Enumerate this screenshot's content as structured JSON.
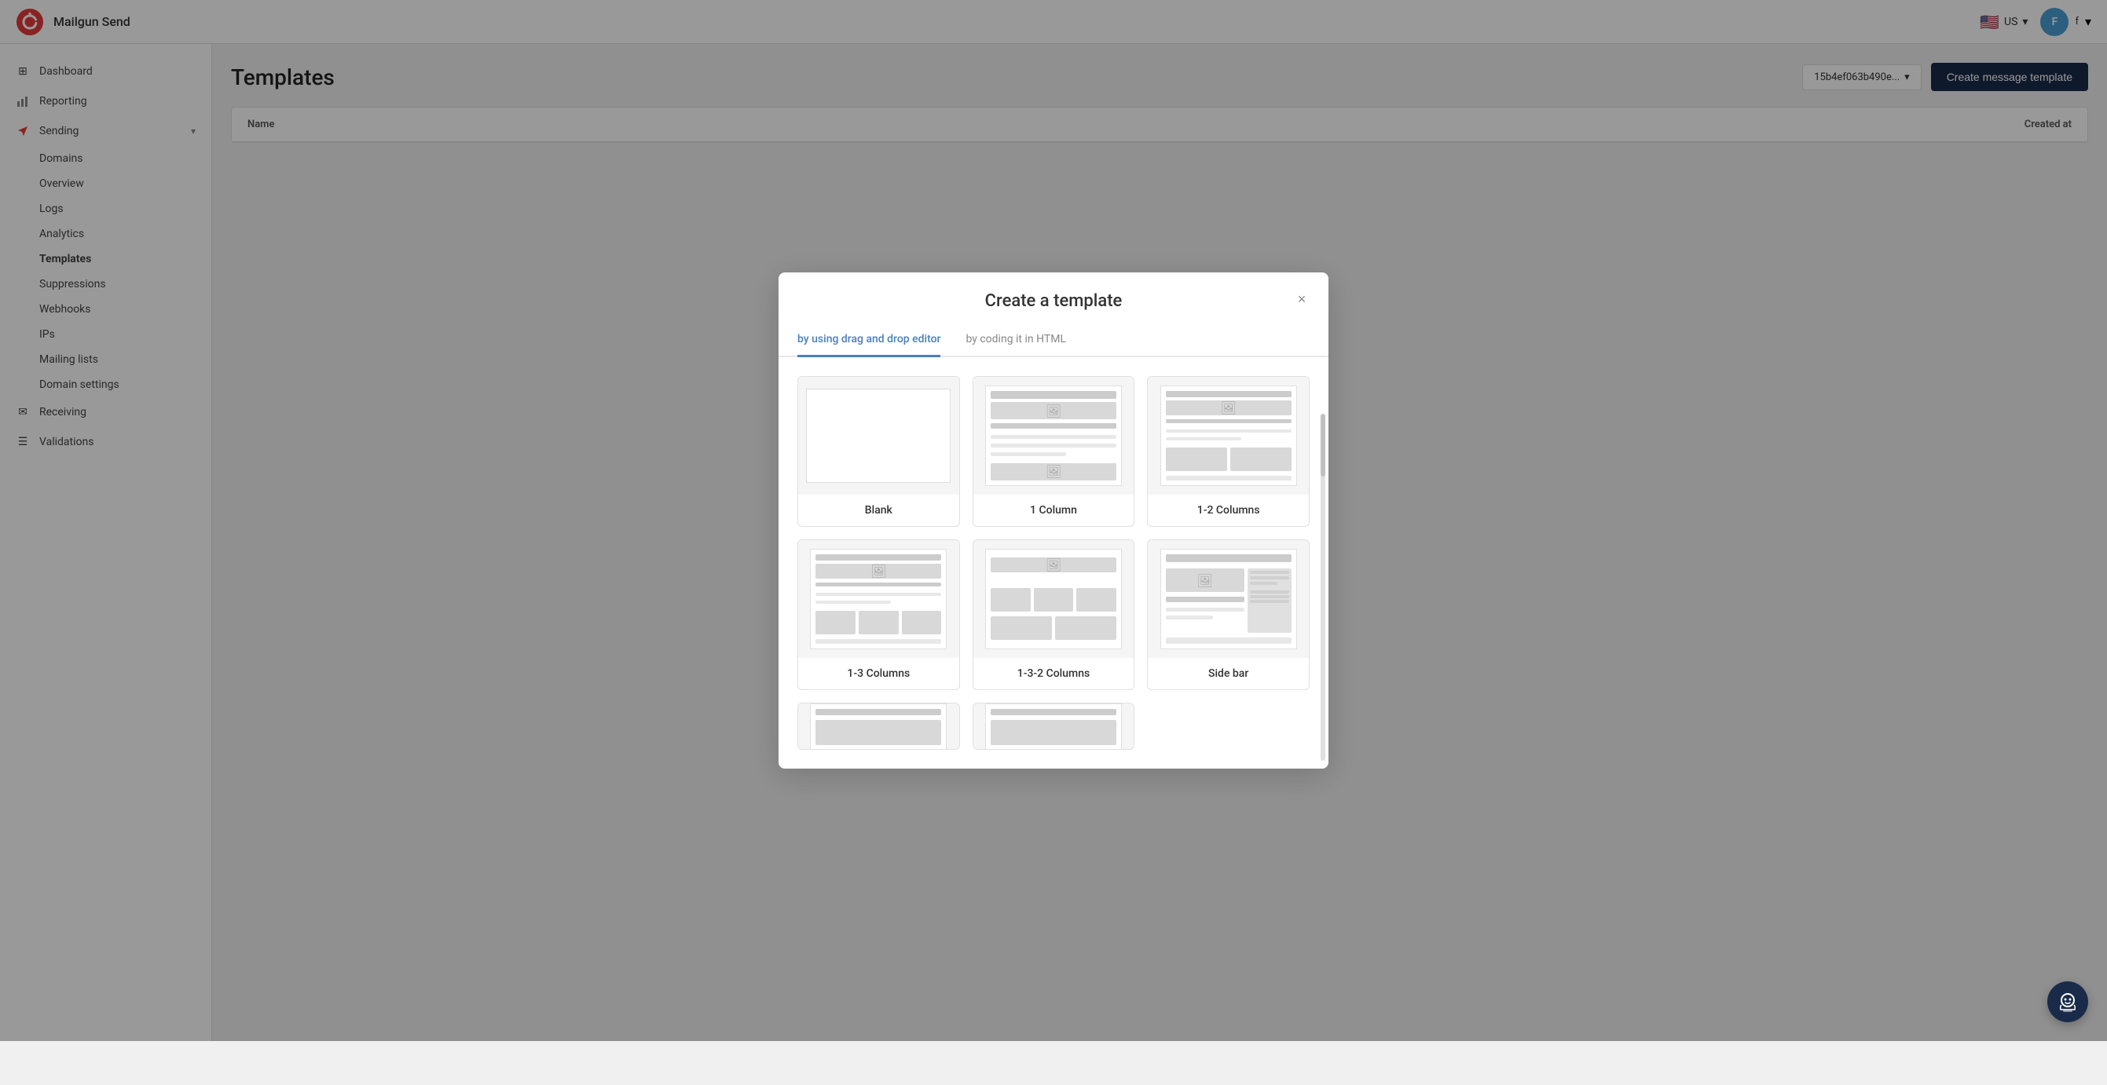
{
  "app": {
    "name": "Mailgun Send",
    "logo_text": "⚙"
  },
  "topnav": {
    "lang": "US",
    "user_initial": "F",
    "user_name": "f",
    "user_sub": "f",
    "chevron": "▾"
  },
  "sidebar": {
    "items": [
      {
        "id": "dashboard",
        "label": "Dashboard",
        "icon": "⊞"
      },
      {
        "id": "reporting",
        "label": "Reporting",
        "icon": "📊"
      },
      {
        "id": "sending",
        "label": "Sending",
        "icon": "✈",
        "has_chevron": true
      },
      {
        "id": "domains",
        "label": "Domains",
        "icon": ""
      },
      {
        "id": "overview",
        "label": "Overview",
        "icon": ""
      },
      {
        "id": "logs",
        "label": "Logs",
        "icon": ""
      },
      {
        "id": "analytics",
        "label": "Analytics",
        "icon": ""
      },
      {
        "id": "templates",
        "label": "Templates",
        "icon": "",
        "active": true
      },
      {
        "id": "suppressions",
        "label": "Suppressions",
        "icon": ""
      },
      {
        "id": "webhooks",
        "label": "Webhooks",
        "icon": ""
      },
      {
        "id": "ips",
        "label": "IPs",
        "icon": ""
      },
      {
        "id": "mailing-lists",
        "label": "Mailing lists",
        "icon": ""
      },
      {
        "id": "domain-settings",
        "label": "Domain settings",
        "icon": ""
      },
      {
        "id": "receiving",
        "label": "Receiving",
        "icon": "✉"
      },
      {
        "id": "validations",
        "label": "Validations",
        "icon": "☰"
      }
    ]
  },
  "page": {
    "title": "Templates",
    "domain_value": "15b4ef063b490e...",
    "create_btn_label": "Create message template",
    "table": {
      "col_name": "Name",
      "col_created": "Created at"
    }
  },
  "modal": {
    "title": "Create a template",
    "close_label": "×",
    "tabs": [
      {
        "id": "drag-drop",
        "label": "by using drag and drop editor",
        "active": true
      },
      {
        "id": "html",
        "label": "by coding it in HTML",
        "active": false
      }
    ],
    "templates": [
      {
        "id": "blank",
        "label": "Blank",
        "type": "blank"
      },
      {
        "id": "1-column",
        "label": "1 Column",
        "type": "one-col"
      },
      {
        "id": "1-2-columns",
        "label": "1-2 Columns",
        "type": "one-two-col"
      },
      {
        "id": "1-3-columns",
        "label": "1-3 Columns",
        "type": "one-three-col"
      },
      {
        "id": "1-3-2-columns",
        "label": "1-3-2 Columns",
        "type": "one-three-two-col"
      },
      {
        "id": "side-bar",
        "label": "Side bar",
        "type": "sidebar"
      },
      {
        "id": "partial-1",
        "label": "",
        "type": "partial1"
      },
      {
        "id": "partial-2",
        "label": "",
        "type": "partial2"
      }
    ]
  },
  "bot": {
    "icon": "🤖"
  }
}
